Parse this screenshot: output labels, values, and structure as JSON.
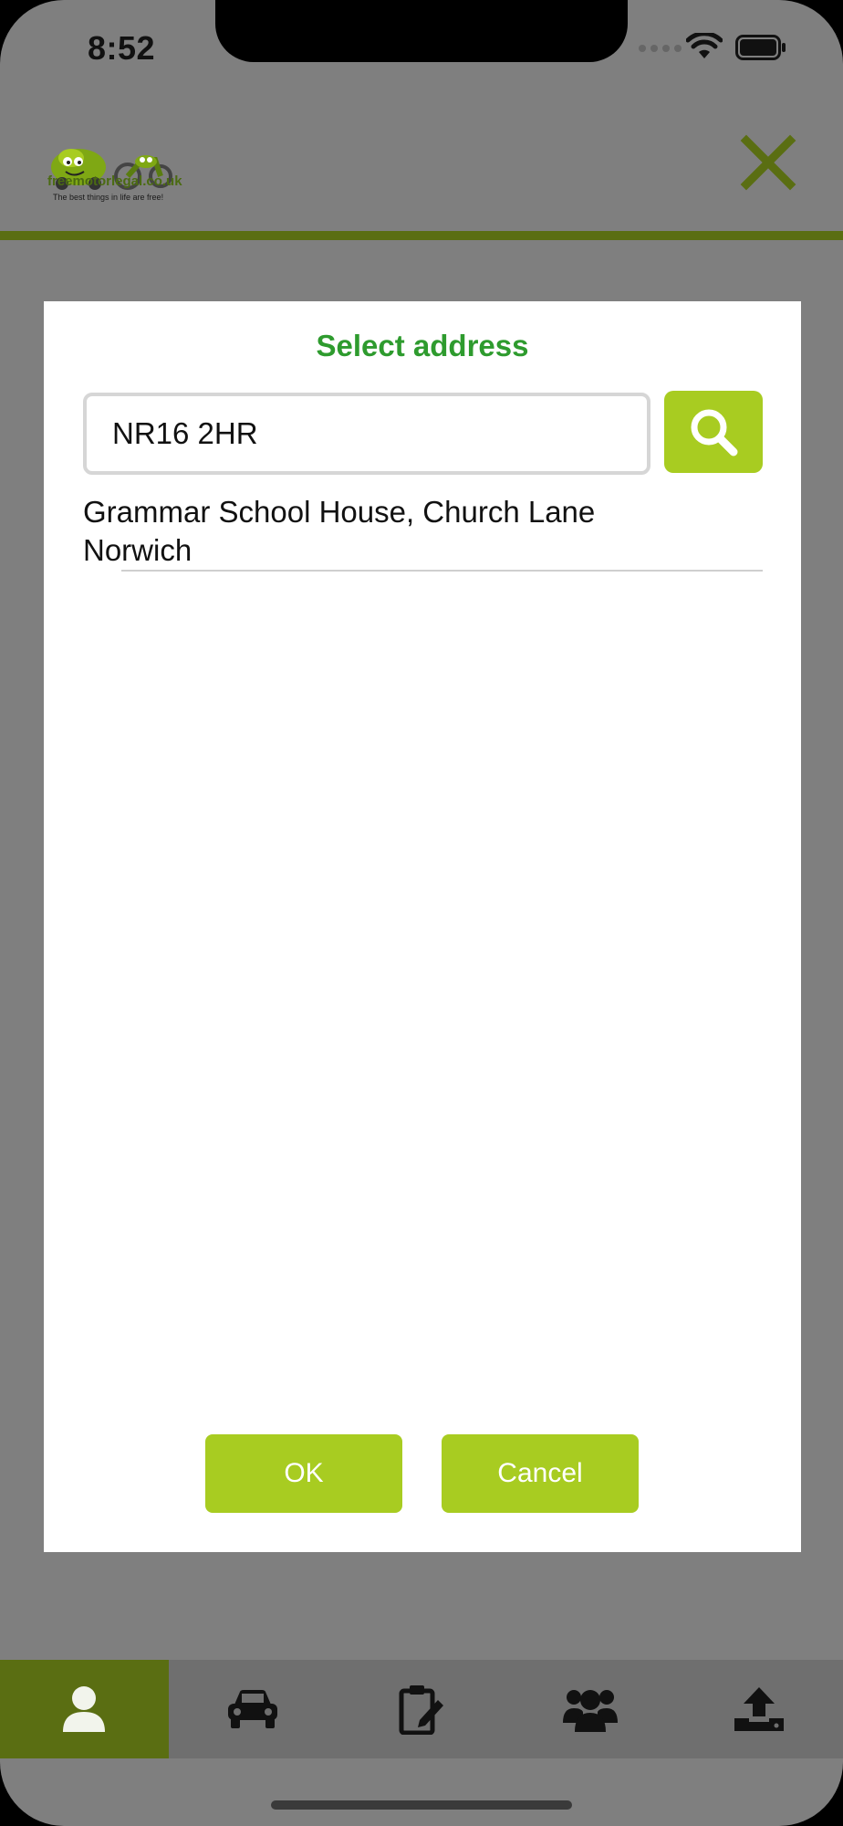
{
  "status_bar": {
    "time": "8:52",
    "icons": [
      "cellular-icon",
      "wifi-icon",
      "battery-icon"
    ]
  },
  "header": {
    "logo_name": "freemotorlegal.co.uk",
    "logo_tagline": "The best things in life are free!",
    "close_icon": "close-icon",
    "accent_color": "#5a6e12"
  },
  "modal": {
    "title": "Select address",
    "search": {
      "value": "NR16 2HR",
      "button_icon": "search-icon"
    },
    "results": [
      {
        "line1": "Grammar School House, Church Lane",
        "line2": "Norwich"
      }
    ],
    "ok_label": "OK",
    "cancel_label": "Cancel",
    "title_color": "#2e9b2e",
    "button_color": "#a8cc21"
  },
  "tabbar": {
    "items": [
      {
        "icon": "person-icon",
        "active": true
      },
      {
        "icon": "car-icon",
        "active": false
      },
      {
        "icon": "clipboard-edit-icon",
        "active": false
      },
      {
        "icon": "group-icon",
        "active": false
      },
      {
        "icon": "upload-icon",
        "active": false
      }
    ]
  }
}
